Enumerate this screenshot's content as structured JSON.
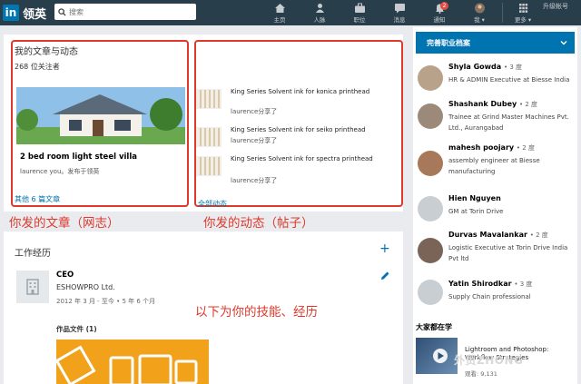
{
  "nav": {
    "logo_mark": "in",
    "logo_text": "领英",
    "search_placeholder": "搜索",
    "items": [
      {
        "label": "主页"
      },
      {
        "label": "人脉"
      },
      {
        "label": "职位"
      },
      {
        "label": "消息"
      },
      {
        "label": "通知",
        "badge": "2"
      },
      {
        "label": "我 ▾"
      },
      {
        "label": "更多 ▾"
      }
    ],
    "upgrade": "升级帐号"
  },
  "articles": {
    "title": "我的文章与动态",
    "followers": "268 位关注者",
    "article_title": "2 bed room light steel villa",
    "article_sub": "laurence you。发布于领英",
    "more_link": "其他 6 篇文章"
  },
  "activity": {
    "posts": [
      {
        "title": "King Series Solvent ink for konica printhead",
        "shared": "laurence分享了"
      },
      {
        "title": "King Series Solvent ink for seiko printhead",
        "shared": "laurence分享了"
      },
      {
        "title": "King Series Solvent ink for spectra printhead",
        "shared": "laurence分享了"
      }
    ],
    "all_link": "全部动态"
  },
  "annotations": {
    "left": "你发的文章（网志）",
    "right": "你发的动态（帖子）",
    "middle": "以下为你的技能、经历"
  },
  "experience": {
    "title": "工作经历",
    "job_title": "CEO",
    "company": "ESHOWPRO Ltd.",
    "dates": "2012 年 3 月 - 至今 • 5 年 6 个月",
    "works_label": "作品文件 (1)"
  },
  "sidebar": {
    "complete_profile": "完善职业档案",
    "people": [
      {
        "name": "Shyla Gowda",
        "degree": "• 3 度",
        "desc": "HR & ADMIN Executive at Biesse India"
      },
      {
        "name": "Shashank Dubey",
        "degree": "• 2 度",
        "desc": "Trainee at Grind Master Machines Pvt. Ltd., Aurangabad"
      },
      {
        "name": "mahesh poojary",
        "degree": "• 2 度",
        "desc": "assembly engineer at Biesse manufacturing"
      },
      {
        "name": "Hien Nguyen",
        "degree": "",
        "desc": "GM at Torin Drive"
      },
      {
        "name": "Durvas Mavalankar",
        "degree": "• 2 度",
        "desc": "Logistic Executive at Torin Drive India Pvt ltd"
      },
      {
        "name": "Yatin Shirodkar",
        "degree": "• 3 度",
        "desc": "Supply Chain professional"
      }
    ],
    "learning_title": "大家都在学",
    "course_title": "Lightroom and Photoshop: Workflow Strategies",
    "course_views": "观看: 9,131",
    "watermark": "外贸ZHONG"
  },
  "colors": {
    "nav": "#283e4a",
    "accent": "#0073b1",
    "annotation": "#e0382b"
  }
}
